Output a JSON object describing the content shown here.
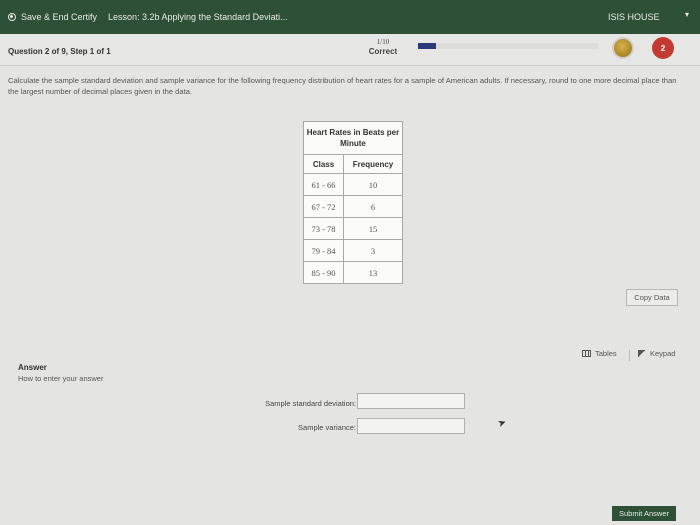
{
  "topbar": {
    "save_label": "Save & End Certify",
    "lesson": "Lesson: 3.2b Applying the Standard Deviati...",
    "user_name": "ISIS HOUSE"
  },
  "question": {
    "title": "Question 2 of 9, Step 1 of 1",
    "score_fraction": "1/10",
    "score_result": "Correct",
    "progress_fraction": 0.1,
    "hearts": "2",
    "progress_color": "#2c3a79",
    "heart_color": "#c33a32",
    "coin_color": "#c69a35"
  },
  "instructions": "Calculate the sample standard deviation and sample variance for the following frequency distribution of heart rates for a sample of American adults. If necessary, round to one more decimal place than the largest number of decimal places given in the data.",
  "table": {
    "caption": "Heart Rates in Beats per Minute",
    "headers": [
      "Class",
      "Frequency"
    ],
    "rows": [
      [
        "61 - 66",
        "10"
      ],
      [
        "67 - 72",
        "6"
      ],
      [
        "73 - 78",
        "15"
      ],
      [
        "79 - 84",
        "3"
      ],
      [
        "85 - 90",
        "13"
      ]
    ]
  },
  "copy_data_label": "Copy Data",
  "tools": {
    "tables_label": "Tables",
    "keypad_label": "Keypad"
  },
  "answer": {
    "label": "Answer",
    "howto": "How to enter your answer",
    "sd_label": "Sample standard deviation:",
    "sd_value": "",
    "var_label": "Sample variance:",
    "var_value": ""
  },
  "submit_label": "Submit Answer",
  "theme": {
    "header_green": "#2e5036",
    "background": "#e4e4e2"
  }
}
